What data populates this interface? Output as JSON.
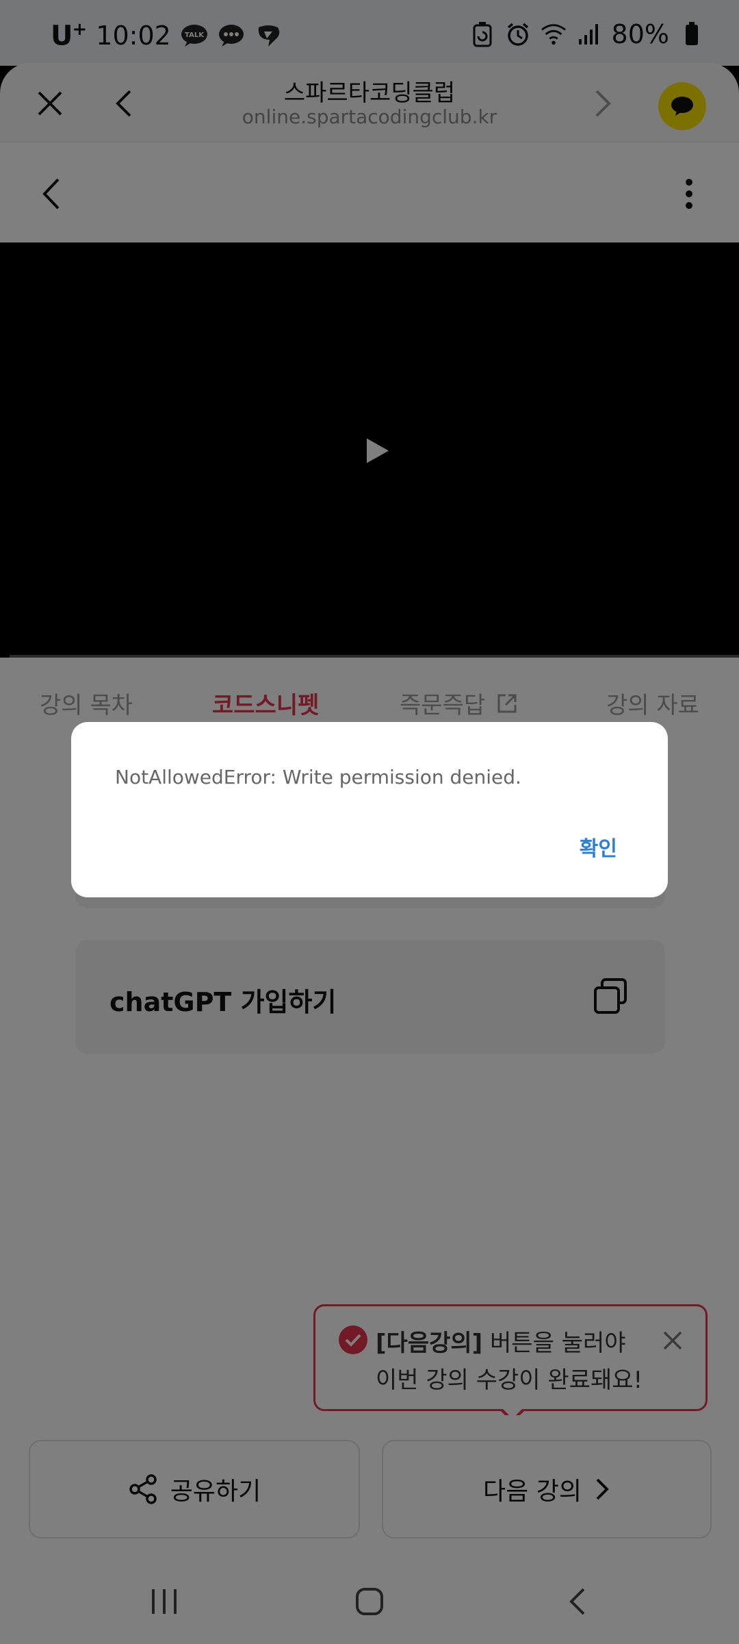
{
  "status_bar": {
    "carrier": "U",
    "carrier_sup": "+",
    "time": "10:02",
    "battery": "80%",
    "notification_icons": [
      "talk-bubble-icon",
      "chat-dots-icon",
      "message-bubble-icon"
    ],
    "system_icons": [
      "battery-saver-icon",
      "alarm-icon",
      "wifi-icon",
      "signal-icon",
      "battery-icon"
    ]
  },
  "browser": {
    "title": "스파르타코딩클럽",
    "url": "online.spartacodingclub.kr"
  },
  "tabs": [
    {
      "label": "강의 목차",
      "active": false
    },
    {
      "label": "코드스니펫",
      "active": true
    },
    {
      "label": "즉문즉답",
      "active": false
    },
    {
      "label": "강의 자료",
      "active": false
    }
  ],
  "snippets": [
    {
      "label": ""
    },
    {
      "label": "chatGPT 가입하기"
    }
  ],
  "tooltip": {
    "bold": "[다음강의]",
    "line1_rest": " 버튼을 눌러야",
    "line2": "이번 강의 수강이 완료돼요!"
  },
  "actions": {
    "share": "공유하기",
    "next": "다음 강의"
  },
  "dialog": {
    "message": "NotAllowedError: Write permission denied.",
    "ok": "확인"
  },
  "colors": {
    "accent": "#e8344e",
    "link": "#2f7fd1",
    "kakao": "#f7e100"
  }
}
